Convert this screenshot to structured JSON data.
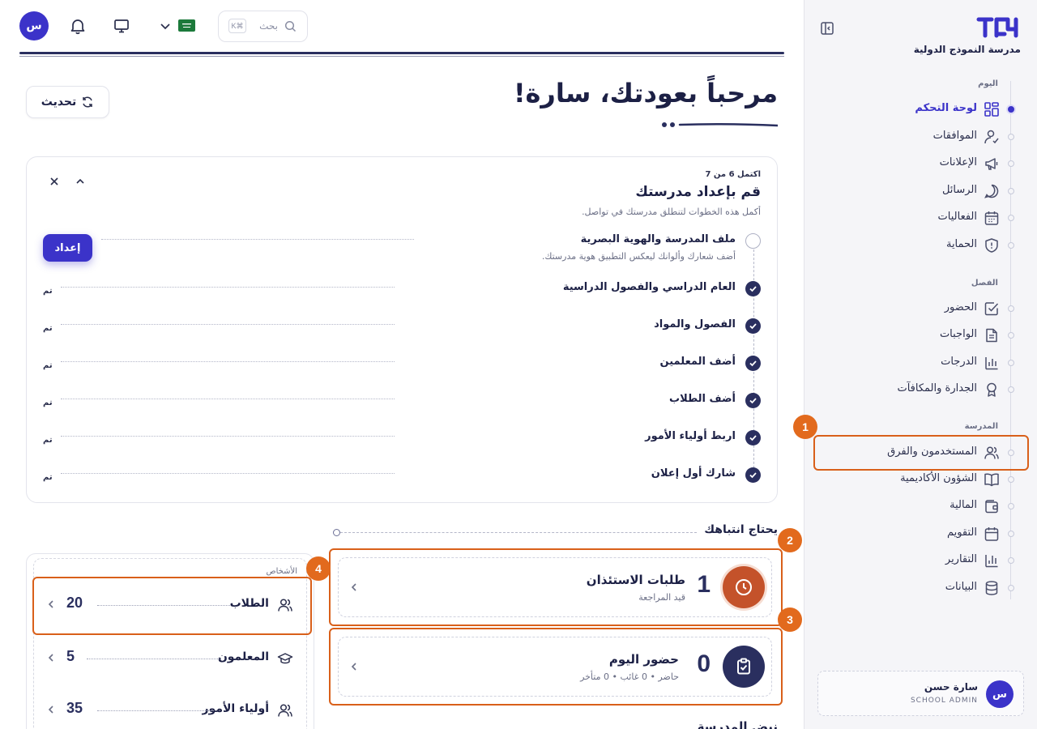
{
  "sidebar": {
    "school_name": "مدرسة النموذج الدولية",
    "sections": [
      {
        "label": "اليوم"
      },
      {
        "label": "الفصل"
      },
      {
        "label": "المدرسة"
      }
    ],
    "items": [
      {
        "label": "لوحة التحكم",
        "icon": "dashboard-icon",
        "active": true
      },
      {
        "label": "الموافقات",
        "icon": "user-check-icon"
      },
      {
        "label": "الإعلانات",
        "icon": "megaphone-icon"
      },
      {
        "label": "الرسائل",
        "icon": "chat-icon"
      },
      {
        "label": "الفعاليات",
        "icon": "calendar-grid-icon"
      },
      {
        "label": "الحماية",
        "icon": "shield-icon"
      },
      {
        "label": "الحضور",
        "icon": "checkbox-icon"
      },
      {
        "label": "الواجبات",
        "icon": "document-icon"
      },
      {
        "label": "الدرجات",
        "icon": "bar-chart-icon"
      },
      {
        "label": "الجدارة والمكافآت",
        "icon": "award-icon"
      },
      {
        "label": "المستخدمون والفرق",
        "icon": "users-icon"
      },
      {
        "label": "الشؤون الأكاديمية",
        "icon": "book-icon"
      },
      {
        "label": "المالية",
        "icon": "wallet-icon"
      },
      {
        "label": "التقويم",
        "icon": "calendar-icon"
      },
      {
        "label": "التقارير",
        "icon": "report-chart-icon"
      },
      {
        "label": "البيانات",
        "icon": "database-icon"
      }
    ],
    "user": {
      "name": "سارة حسن",
      "role": "SCHOOL ADMIN",
      "avatar_letter": "س"
    }
  },
  "topbar": {
    "avatar_letter": "س",
    "search_placeholder": "بحث",
    "search_shortcut": "K⌘"
  },
  "header": {
    "welcome": "مرحباً بعودتك، سارة!",
    "refresh_label": "تحديث"
  },
  "setup": {
    "progress": "اكتمل 6 من 7",
    "title": "قم بإعداد مدرستك",
    "subtitle": "أكمل هذه الخطوات لتنطلق مدرستك في تواصل.",
    "setup_button": "إعداد",
    "steps": [
      {
        "title": "ملف المدرسة والهوية البصرية",
        "desc": "أضف شعارك وألوانك ليعكس التطبيق هوية مدرستك.",
        "done": false
      },
      {
        "title": "العام الدراسي والفصول الدراسية",
        "done": true,
        "status": "تم"
      },
      {
        "title": "الفصول والمواد",
        "done": true,
        "status": "تم"
      },
      {
        "title": "أضف المعلمين",
        "done": true,
        "status": "تم"
      },
      {
        "title": "أضف الطلاب",
        "done": true,
        "status": "تم"
      },
      {
        "title": "اربط أولياء الأمور",
        "done": true,
        "status": "تم"
      },
      {
        "title": "شارك أول إعلان",
        "done": true,
        "status": "تم"
      }
    ]
  },
  "attention": {
    "title": "يحتاج انتباهك",
    "cards": [
      {
        "count": "1",
        "label": "طلبات الاستئذان",
        "sub": "قيد المراجعة",
        "icon": "clock-icon",
        "color": "#c4522a"
      },
      {
        "count": "0",
        "label": "حضور اليوم",
        "sub": "حاضر • 0 غائب • 0 متأخر",
        "icon": "clipboard-check-icon",
        "color": "#2a2f5f"
      }
    ]
  },
  "people": {
    "label": "الأشخاص",
    "rows": [
      {
        "label": "الطلاب",
        "count": "20",
        "icon": "users-icon"
      },
      {
        "label": "المعلمون",
        "count": "5",
        "icon": "graduation-cap-icon"
      },
      {
        "label": "أولياء الأمور",
        "count": "35",
        "icon": "users-icon"
      }
    ]
  },
  "bottom_peek": "نبض المدرسة",
  "annotations": [
    "1",
    "2",
    "3",
    "4"
  ],
  "colors": {
    "accent": "#3b33c9",
    "navy": "#2a2f5f",
    "highlight": "#d9601a",
    "alert": "#c4522a"
  }
}
